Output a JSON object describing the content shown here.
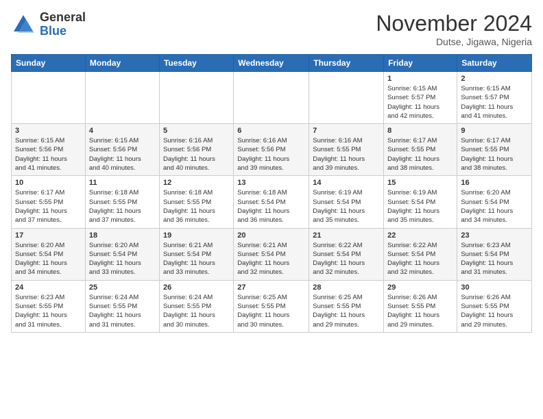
{
  "header": {
    "logo_general": "General",
    "logo_blue": "Blue",
    "month": "November 2024",
    "location": "Dutse, Jigawa, Nigeria"
  },
  "days_of_week": [
    "Sunday",
    "Monday",
    "Tuesday",
    "Wednesday",
    "Thursday",
    "Friday",
    "Saturday"
  ],
  "weeks": [
    [
      {
        "day": "",
        "info": ""
      },
      {
        "day": "",
        "info": ""
      },
      {
        "day": "",
        "info": ""
      },
      {
        "day": "",
        "info": ""
      },
      {
        "day": "",
        "info": ""
      },
      {
        "day": "1",
        "info": "Sunrise: 6:15 AM\nSunset: 5:57 PM\nDaylight: 11 hours\nand 42 minutes."
      },
      {
        "day": "2",
        "info": "Sunrise: 6:15 AM\nSunset: 5:57 PM\nDaylight: 11 hours\nand 41 minutes."
      }
    ],
    [
      {
        "day": "3",
        "info": "Sunrise: 6:15 AM\nSunset: 5:56 PM\nDaylight: 11 hours\nand 41 minutes."
      },
      {
        "day": "4",
        "info": "Sunrise: 6:15 AM\nSunset: 5:56 PM\nDaylight: 11 hours\nand 40 minutes."
      },
      {
        "day": "5",
        "info": "Sunrise: 6:16 AM\nSunset: 5:56 PM\nDaylight: 11 hours\nand 40 minutes."
      },
      {
        "day": "6",
        "info": "Sunrise: 6:16 AM\nSunset: 5:56 PM\nDaylight: 11 hours\nand 39 minutes."
      },
      {
        "day": "7",
        "info": "Sunrise: 6:16 AM\nSunset: 5:55 PM\nDaylight: 11 hours\nand 39 minutes."
      },
      {
        "day": "8",
        "info": "Sunrise: 6:17 AM\nSunset: 5:55 PM\nDaylight: 11 hours\nand 38 minutes."
      },
      {
        "day": "9",
        "info": "Sunrise: 6:17 AM\nSunset: 5:55 PM\nDaylight: 11 hours\nand 38 minutes."
      }
    ],
    [
      {
        "day": "10",
        "info": "Sunrise: 6:17 AM\nSunset: 5:55 PM\nDaylight: 11 hours\nand 37 minutes."
      },
      {
        "day": "11",
        "info": "Sunrise: 6:18 AM\nSunset: 5:55 PM\nDaylight: 11 hours\nand 37 minutes."
      },
      {
        "day": "12",
        "info": "Sunrise: 6:18 AM\nSunset: 5:55 PM\nDaylight: 11 hours\nand 36 minutes."
      },
      {
        "day": "13",
        "info": "Sunrise: 6:18 AM\nSunset: 5:54 PM\nDaylight: 11 hours\nand 36 minutes."
      },
      {
        "day": "14",
        "info": "Sunrise: 6:19 AM\nSunset: 5:54 PM\nDaylight: 11 hours\nand 35 minutes."
      },
      {
        "day": "15",
        "info": "Sunrise: 6:19 AM\nSunset: 5:54 PM\nDaylight: 11 hours\nand 35 minutes."
      },
      {
        "day": "16",
        "info": "Sunrise: 6:20 AM\nSunset: 5:54 PM\nDaylight: 11 hours\nand 34 minutes."
      }
    ],
    [
      {
        "day": "17",
        "info": "Sunrise: 6:20 AM\nSunset: 5:54 PM\nDaylight: 11 hours\nand 34 minutes."
      },
      {
        "day": "18",
        "info": "Sunrise: 6:20 AM\nSunset: 5:54 PM\nDaylight: 11 hours\nand 33 minutes."
      },
      {
        "day": "19",
        "info": "Sunrise: 6:21 AM\nSunset: 5:54 PM\nDaylight: 11 hours\nand 33 minutes."
      },
      {
        "day": "20",
        "info": "Sunrise: 6:21 AM\nSunset: 5:54 PM\nDaylight: 11 hours\nand 32 minutes."
      },
      {
        "day": "21",
        "info": "Sunrise: 6:22 AM\nSunset: 5:54 PM\nDaylight: 11 hours\nand 32 minutes."
      },
      {
        "day": "22",
        "info": "Sunrise: 6:22 AM\nSunset: 5:54 PM\nDaylight: 11 hours\nand 32 minutes."
      },
      {
        "day": "23",
        "info": "Sunrise: 6:23 AM\nSunset: 5:54 PM\nDaylight: 11 hours\nand 31 minutes."
      }
    ],
    [
      {
        "day": "24",
        "info": "Sunrise: 6:23 AM\nSunset: 5:55 PM\nDaylight: 11 hours\nand 31 minutes."
      },
      {
        "day": "25",
        "info": "Sunrise: 6:24 AM\nSunset: 5:55 PM\nDaylight: 11 hours\nand 31 minutes."
      },
      {
        "day": "26",
        "info": "Sunrise: 6:24 AM\nSunset: 5:55 PM\nDaylight: 11 hours\nand 30 minutes."
      },
      {
        "day": "27",
        "info": "Sunrise: 6:25 AM\nSunset: 5:55 PM\nDaylight: 11 hours\nand 30 minutes."
      },
      {
        "day": "28",
        "info": "Sunrise: 6:25 AM\nSunset: 5:55 PM\nDaylight: 11 hours\nand 29 minutes."
      },
      {
        "day": "29",
        "info": "Sunrise: 6:26 AM\nSunset: 5:55 PM\nDaylight: 11 hours\nand 29 minutes."
      },
      {
        "day": "30",
        "info": "Sunrise: 6:26 AM\nSunset: 5:55 PM\nDaylight: 11 hours\nand 29 minutes."
      }
    ]
  ]
}
